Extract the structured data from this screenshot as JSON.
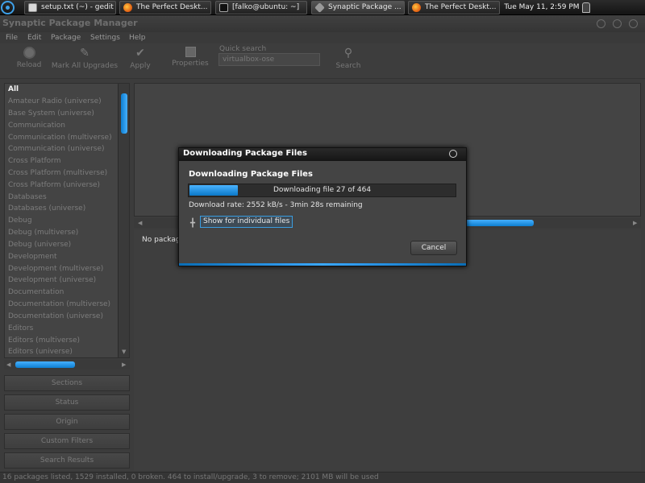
{
  "taskbar": {
    "tasks": [
      {
        "label": "setup.txt (~) - gedit",
        "icon": "gedit-icon"
      },
      {
        "label": "The Perfect Deskt...",
        "icon": "firefox-icon"
      },
      {
        "label": "[falko@ubuntu: ~]",
        "icon": "terminal-icon"
      },
      {
        "label": "Synaptic Package ...",
        "icon": "synaptic-icon"
      },
      {
        "label": "The Perfect Deskt...",
        "icon": "firefox-icon"
      }
    ],
    "clock": "Tue May 11,  2:59 PM"
  },
  "window": {
    "title": "Synaptic Package Manager"
  },
  "menubar": {
    "items": [
      "File",
      "Edit",
      "Package",
      "Settings",
      "Help"
    ]
  },
  "toolbar": {
    "reload": "Reload",
    "mark_all": "Mark All Upgrades",
    "apply": "Apply",
    "properties": "Properties",
    "quick_search_label": "Quick search",
    "quick_search_value": "virtualbox-ose",
    "search": "Search"
  },
  "sidebar": {
    "categories": [
      "All",
      "Amateur Radio (universe)",
      "Base System (universe)",
      "Communication",
      "Communication (multiverse)",
      "Communication (universe)",
      "Cross Platform",
      "Cross Platform (multiverse)",
      "Cross Platform (universe)",
      "Databases",
      "Databases (universe)",
      "Debug",
      "Debug (multiverse)",
      "Debug (universe)",
      "Development",
      "Development (multiverse)",
      "Development (universe)",
      "Documentation",
      "Documentation (multiverse)",
      "Documentation (universe)",
      "Editors",
      "Editors (multiverse)",
      "Editors (universe)"
    ],
    "buttons": [
      "Sections",
      "Status",
      "Origin",
      "Custom Filters",
      "Search Results"
    ]
  },
  "main": {
    "no_package": "No package"
  },
  "statusbar": {
    "text": "16 packages listed, 1529 installed, 0 broken. 464 to install/upgrade, 3 to remove; 2101 MB will be used"
  },
  "dialog": {
    "title": "Downloading Package Files",
    "heading": "Downloading Package Files",
    "progress_text": "Downloading file 27 of 464",
    "progress_fraction": 0.058,
    "rate": "Download rate: 2552 kB/s - 3min 28s remaining",
    "show_files": "Show for individual files",
    "cancel": "Cancel"
  },
  "colors": {
    "accent": "#1e90ff",
    "background": "#3c3c3c"
  }
}
